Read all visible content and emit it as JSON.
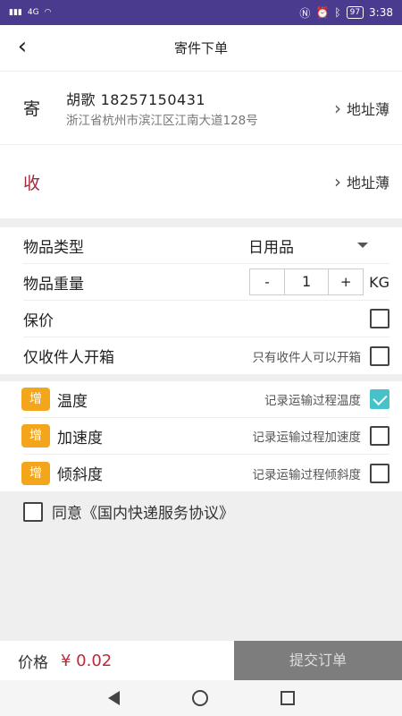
{
  "status": {
    "signal_left": "4G",
    "time": "3:38",
    "battery": "97"
  },
  "header": {
    "title": "寄件下单"
  },
  "sender": {
    "tag": "寄",
    "name": "胡歌  18257150431",
    "address": "浙江省杭州市滨江区江南大道128号",
    "book_label": "地址薄"
  },
  "receiver": {
    "tag": "收",
    "book_label": "地址薄"
  },
  "form": {
    "category_label": "物品类型",
    "category_value": "日用品",
    "weight_label": "物品重量",
    "weight_minus": "-",
    "weight_value": "1",
    "weight_plus": "+",
    "weight_unit": "KG",
    "insurance_label": "保价",
    "recipient_only_label": "仅收件人开箱",
    "recipient_only_hint": "只有收件人可以开箱"
  },
  "addons": {
    "badge": "增",
    "items": [
      {
        "label": "温度",
        "hint": "记录运输过程温度",
        "checked": true
      },
      {
        "label": "加速度",
        "hint": "记录运输过程加速度",
        "checked": false
      },
      {
        "label": "倾斜度",
        "hint": "记录运输过程倾斜度",
        "checked": false
      }
    ]
  },
  "agreement": {
    "text": "同意《国内快递服务协议》"
  },
  "footer": {
    "price_label": "价格",
    "price_value": "¥ 0.02",
    "submit_label": "提交订单"
  },
  "colors": {
    "accent": "#47c2c9",
    "badge": "#f3a51b",
    "status_bar": "#4b3b8f",
    "price": "#c0283a"
  }
}
